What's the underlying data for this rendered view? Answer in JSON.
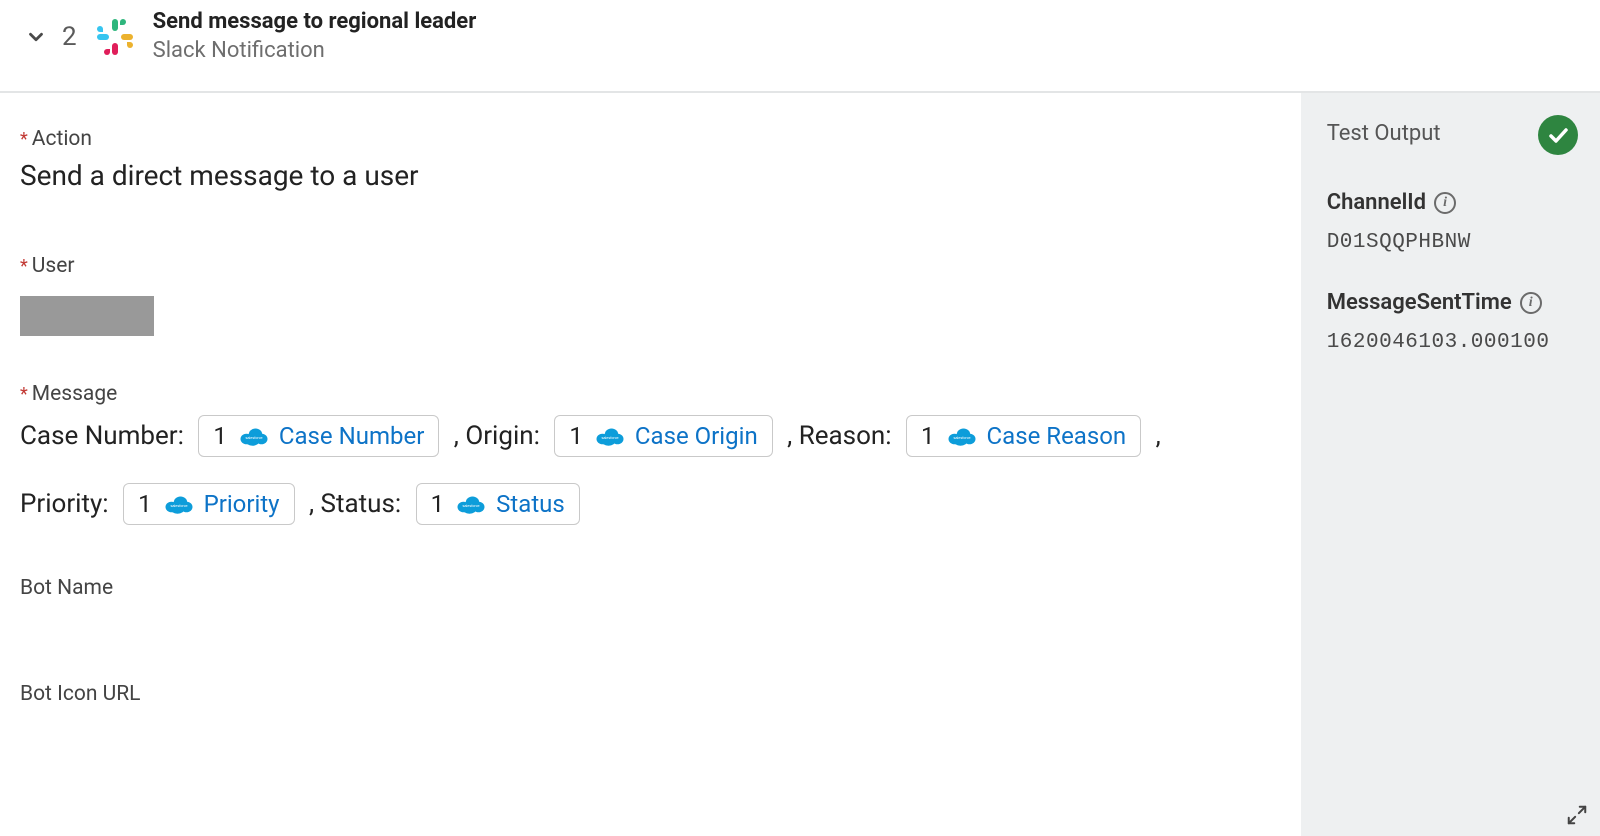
{
  "header": {
    "step_number": "2",
    "title": "Send message to regional leader",
    "subtitle": "Slack Notification"
  },
  "form": {
    "action": {
      "label": "Action",
      "value": "Send a direct message to a user"
    },
    "user": {
      "label": "User"
    },
    "message": {
      "label": "Message",
      "segments": [
        {
          "type": "text",
          "value": "Case Number: "
        },
        {
          "type": "pill",
          "index": "1",
          "label": "Case Number"
        },
        {
          "type": "text",
          "value": " , Origin: "
        },
        {
          "type": "pill",
          "index": "1",
          "label": "Case Origin"
        },
        {
          "type": "text",
          "value": " , Reason: "
        },
        {
          "type": "pill",
          "index": "1",
          "label": "Case Reason"
        },
        {
          "type": "text",
          "value": " , "
        },
        {
          "type": "break"
        },
        {
          "type": "text",
          "value": "Priority: "
        },
        {
          "type": "pill",
          "index": "1",
          "label": "Priority"
        },
        {
          "type": "text",
          "value": " , Status: "
        },
        {
          "type": "pill",
          "index": "1",
          "label": "Status"
        }
      ]
    },
    "bot_name": {
      "label": "Bot Name"
    },
    "bot_icon_url": {
      "label": "Bot Icon URL"
    }
  },
  "test_output": {
    "title": "Test Output",
    "status": "success",
    "fields": [
      {
        "label": "ChannelId",
        "value": "D01SQQPHBNW"
      },
      {
        "label": "MessageSentTime",
        "value": "1620046103.000100"
      }
    ]
  }
}
